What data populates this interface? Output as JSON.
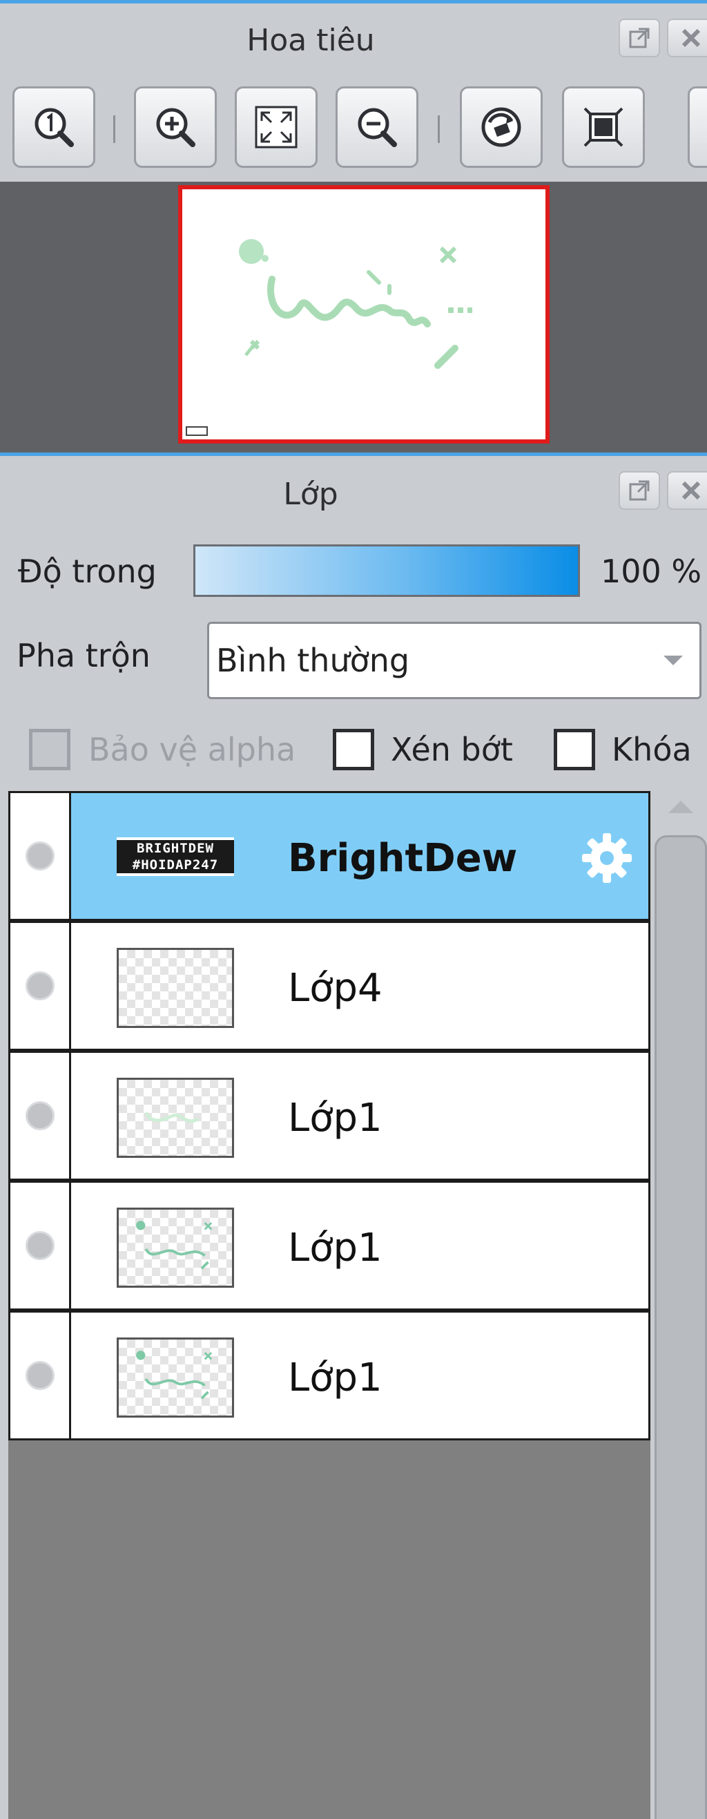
{
  "navigator": {
    "title": "Hoa tiêu"
  },
  "layers_panel": {
    "title": "Lớp",
    "opacity": {
      "label": "Độ trong",
      "value": "100 %",
      "fraction": 1.0
    },
    "blend": {
      "label": "Pha trộn",
      "value": "Bình thường"
    },
    "options": {
      "protect_alpha": "Bảo vệ alpha",
      "clip": "Xén bớt",
      "lock": "Khóa"
    },
    "thumbnail_text": [
      "BRIGHTDEW",
      "#HOIDAP247"
    ],
    "layers": [
      {
        "name": "BrightDew"
      },
      {
        "name": "Lớp4"
      },
      {
        "name": "Lớp1"
      },
      {
        "name": "Lớp1"
      },
      {
        "name": "Lớp1"
      }
    ]
  },
  "colors": {
    "accent": "#4aa3e6",
    "selected_row": "#7fcdf6",
    "preview_border": "#e01b1b",
    "artwork": "#a9dcb5"
  }
}
